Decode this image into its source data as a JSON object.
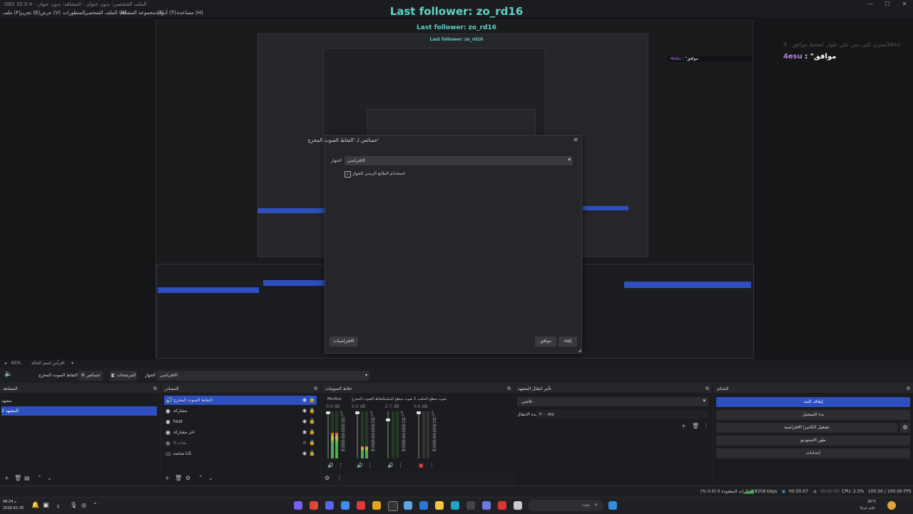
{
  "window": {
    "title": "OBS 32.0.4 - الملف الشخصي: بدون عنوان - المشاهد: بدون عنوان",
    "controls": [
      "—",
      "☐",
      "✕"
    ]
  },
  "menu": [
    "ملف (F)",
    "تحرير (E)",
    "عرض (V)",
    "المنظورات",
    "الملف الشخصي (P)",
    "مجموعة المشاهد (S)",
    "أدوات (T)",
    "مساعدة (H)"
  ],
  "preview": {
    "follower_text": "Last follower: zo_rd16",
    "chat_faded": "لاتسري كتي بس علي طول اضغط موافق : 4esu",
    "chat_user": "4esu",
    "chat_message": ": \"موافق"
  },
  "dialog": {
    "title": "خصائص لـ 'التقاط الصوت المخرج'",
    "close": "✕",
    "device_label": "الجهاز",
    "device_value": "الافتراضي",
    "checkbox_label": "استخدام الطابع الزمني للجهاز",
    "checkbox_checked": true,
    "defaults_button": "الافتراضيات",
    "ok_button": "موافق",
    "cancel_button": "إلغاء"
  },
  "toolbar": {
    "zoom": "65%",
    "zoom_hint": "اقرأس لسم الحالة",
    "source_name": "التقاط الصوت المخرج",
    "properties_button": "خصائص",
    "filters_button": "المرشحات",
    "device_label": "الجهاز",
    "device_value": "الافتراضي"
  },
  "scenes": {
    "title": "المشاهد",
    "items": [
      {
        "label": "مشهد",
        "selected": false
      },
      {
        "label": "المشهد 2",
        "selected": true
      }
    ]
  },
  "sources": {
    "title": "المصادر",
    "items": [
      {
        "label": "التقاط الصوت المخرج",
        "icon": "🔊",
        "selected": true
      },
      {
        "label": "مشاركة",
        "icon": "◉",
        "selected": false
      },
      {
        "label": "host",
        "icon": "◉",
        "selected": false
      },
      {
        "label": "اخر مشاركة",
        "icon": "◉",
        "selected": false
      },
      {
        "label": "شات 6",
        "icon": "◉",
        "selected": false
      },
      {
        "label": "شاشة LG",
        "icon": "▭",
        "selected": false
      }
    ]
  },
  "mixer": {
    "title": "خلاط الصوتيات",
    "scale": "0\n-5\n-10\n-15\n-20\n-25\n-30\n-35\n-40\n-45\n-50\n-55\n-60",
    "channels": [
      {
        "name": "Mic/Aux",
        "db": "0.0 dB",
        "level": 0.55
      },
      {
        "name": "التقاط الصوت المخرج",
        "db": "0.0 dB",
        "level": 0.25
      },
      {
        "name": "صوت سطح المكتب",
        "db": "-2.7 dB",
        "level": 0.0
      },
      {
        "name": "صوت سطح المكتب 2",
        "db": "0.0 dB",
        "level": 0.0
      }
    ]
  },
  "transitions": {
    "title": "تأثير انتقال المشهد",
    "type_value": "تلاشي",
    "duration_label": "مدة الانتقال",
    "duration_value": "٣٠٠ ms"
  },
  "controls": {
    "title": "التحكم",
    "buttons": [
      {
        "label": "إيقاف البث",
        "active": true
      },
      {
        "label": "بدء التسجيل",
        "active": false
      },
      {
        "label": "تشغيل الكاميرا الافتراضية",
        "active": false
      },
      {
        "label": "طور الاستوديو",
        "active": false
      },
      {
        "label": "إعدادات",
        "active": false
      }
    ]
  },
  "status": {
    "dropped": "الإطارات المفقودة 0 (0.0 %)",
    "bitrate": "8258 kbps",
    "stream_time": "00:30:07",
    "rec_time": "00:00:00",
    "cpu": "CPU: 2.5%",
    "fps": "100.00 / 100.00 FPS"
  },
  "taskbar": {
    "time": "08:24 م",
    "date": "2026-02-28",
    "lang": "ع",
    "search_placeholder": "بحث",
    "weather_temp": "20°C",
    "weather_desc": "غائم جزئيًا"
  },
  "colors": {
    "accent": "#2e4fbf",
    "follower": "#5fd1c6",
    "chat_user": "#b57edc"
  }
}
